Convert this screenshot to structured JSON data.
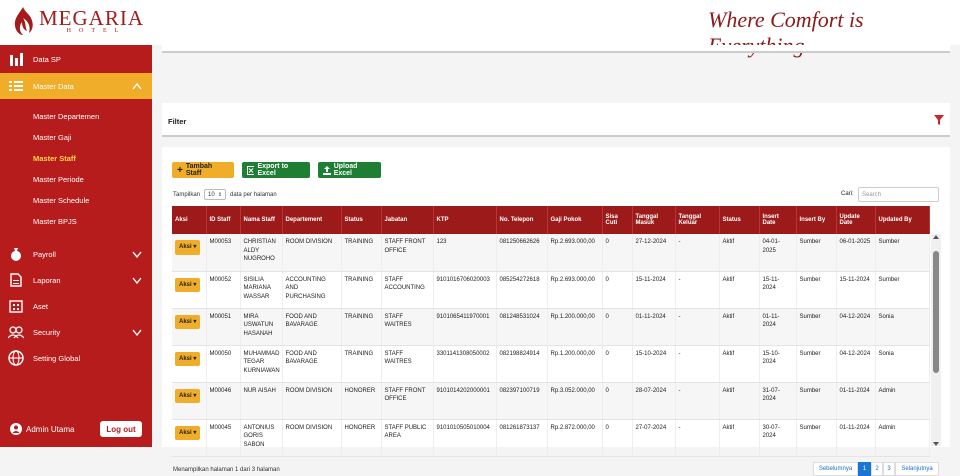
{
  "brand": {
    "name": "MEGARIA",
    "sub": "HOTEL",
    "tagline": "Where Comfort is Everything"
  },
  "colors": {
    "primary": "#b71c1c",
    "accent": "#f0ad2a",
    "success": "#1e7e34",
    "link": "#1976d2"
  },
  "sidebar": {
    "items": [
      {
        "label": "Data SP",
        "icon": "chart-bar-icon"
      },
      {
        "label": "Master Data",
        "icon": "list-icon"
      },
      {
        "label": "Payroll",
        "icon": "money-bag-icon"
      },
      {
        "label": "Laporan",
        "icon": "document-icon"
      },
      {
        "label": "Aset",
        "icon": "building-icon"
      },
      {
        "label": "Security",
        "icon": "users-icon"
      },
      {
        "label": "Setting Global",
        "icon": "globe-icon"
      }
    ],
    "sub": [
      "Master Departemen",
      "Master Gaji",
      "Master Staff",
      "Master Periode",
      "Master Schedule",
      "Master BPJS"
    ],
    "user": "Admin Utama",
    "logout": "Log out"
  },
  "filter": {
    "title": "Filter"
  },
  "toolbar": {
    "add": "Tambah Staff",
    "export": "Export to Excel",
    "upload": "Upload Excel"
  },
  "length": {
    "prefix": "Tampilkan",
    "value": "10",
    "suffix": "data per halaman"
  },
  "search": {
    "label": "Cari:",
    "placeholder": "Search"
  },
  "table": {
    "headers": [
      "Aksi",
      "ID Staff",
      "Nama Staff",
      "Departement",
      "Status",
      "Jabatan",
      "KTP",
      "No. Telepon",
      "Gaji Pokok",
      "Sisa Cuti",
      "Tanggal Masuk",
      "Tanggal Keluar",
      "Status",
      "Insert Date",
      "Insert By",
      "Update Date",
      "Updated By"
    ],
    "action_label": "Aksi",
    "rows": [
      [
        "M00053",
        "CHRISTIAN ALDY NUGROHO",
        "ROOM DIVISION",
        "TRAINING",
        "STAFF FRONT OFFICE",
        "123",
        "081250662626",
        "Rp.2.693.000,00",
        "0",
        "27-12-2024",
        "-",
        "Aktif",
        "04-01-2025",
        "Sumber",
        "06-01-2025",
        "Sumber"
      ],
      [
        "M00052",
        "SISILIA MARIANA WASSAR",
        "ACCOUNTING AND PURCHASING",
        "TRAINING",
        "STAFF ACCOUNTING",
        "9101016706020003",
        "085254272618",
        "Rp.2.693.000,00",
        "0",
        "15-11-2024",
        "-",
        "Aktif",
        "15-11-2024",
        "Sumber",
        "15-11-2024",
        "Sumber"
      ],
      [
        "M00051",
        "MIRA USWATUN HASANAH",
        "FOOD AND BAVARAGE",
        "TRAINING",
        "STAFF WAITRES",
        "9101065411970001",
        "081248531024",
        "Rp.1.200.000,00",
        "0",
        "01-11-2024",
        "-",
        "Aktif",
        "01-11-2024",
        "Sumber",
        "04-12-2024",
        "Sonia"
      ],
      [
        "M00050",
        "MUHAMMAD TEGAR KURNIAWAN",
        "FOOD AND BAVARAGE",
        "TRAINING",
        "STAFF WAITRES",
        "3301141308050002",
        "082198824914",
        "Rp.1.200.000,00",
        "0",
        "15-10-2024",
        "-",
        "Aktif",
        "15-10-2024",
        "Sumber",
        "04-12-2024",
        "Sonia"
      ],
      [
        "M00046",
        "NUR AISAH",
        "ROOM DIVISION",
        "HONORER",
        "STAFF FRONT OFFICE",
        "9101014202000001",
        "082397100719",
        "Rp.3.052.000,00",
        "0",
        "28-07-2024",
        "-",
        "Aktif",
        "31-07-2024",
        "Sumber",
        "01-11-2024",
        "Admin"
      ],
      [
        "M00045",
        "ANTONIUS GORIS SABON",
        "ROOM DIVISION",
        "HONORER",
        "STAFF PUBLIC AREA",
        "9101010505010004",
        "081261873137",
        "Rp.2.872.000,00",
        "0",
        "27-07-2024",
        "-",
        "Aktif",
        "30-07-2024",
        "Sumber",
        "01-11-2024",
        "Admin"
      ]
    ]
  },
  "pagination": {
    "info": "Menampilkan halaman 1 dari 3 halaman",
    "prev": "Sebelumnya",
    "pages": [
      "1",
      "2",
      "3"
    ],
    "next": "Selanjutnya",
    "current": "1"
  }
}
